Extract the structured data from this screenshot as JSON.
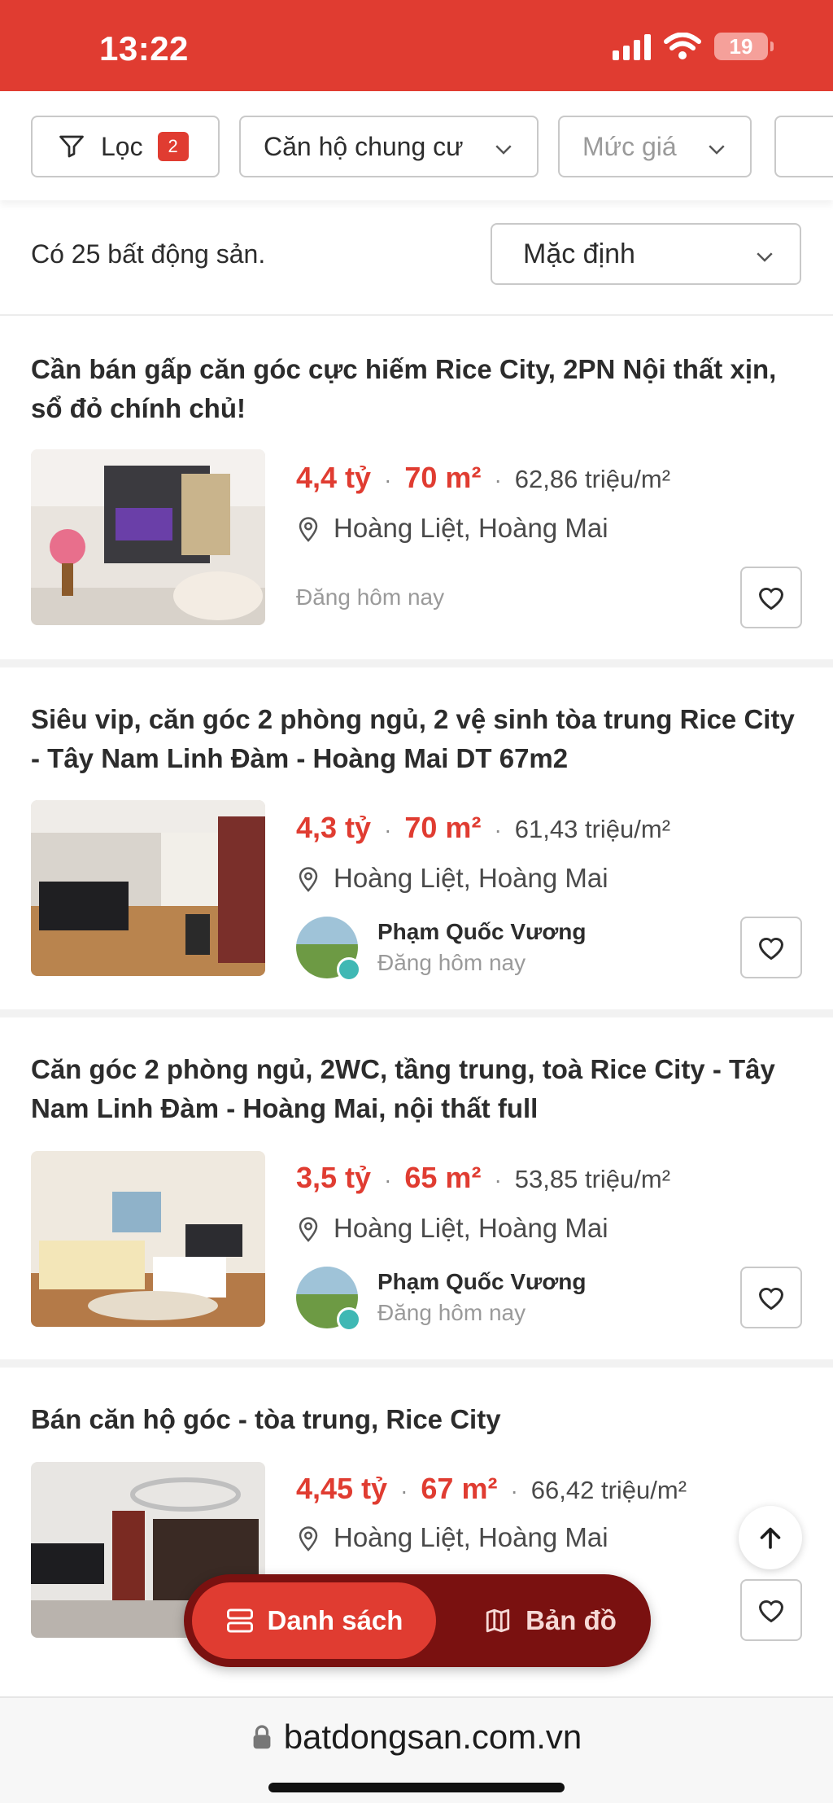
{
  "status_bar": {
    "time": "13:22",
    "battery": "19",
    "bg_color": "#e03c31"
  },
  "filters": {
    "filter_label": "Lọc",
    "filter_count": "2",
    "property_type": "Căn hộ chung cư",
    "price_placeholder": "Mức giá"
  },
  "results": {
    "count_text": "Có 25 bất động sản.",
    "sort_label": "Mặc định"
  },
  "listings": [
    {
      "title": "Cần bán gấp căn góc cực hiếm Rice City, 2PN Nội thất xịn, sổ đỏ chính chủ!",
      "price": "4,4 tỷ",
      "area": "70 m²",
      "price_per_m2": "62,86 triệu/m²",
      "location": "Hoàng Liệt, Hoàng Mai",
      "posted": "Đăng hôm nay"
    },
    {
      "title": "Siêu vip, căn góc 2 phòng ngủ, 2 vệ sinh tòa trung Rice City - Tây Nam Linh Đàm - Hoàng Mai DT 67m2",
      "price": "4,3 tỷ",
      "area": "70 m²",
      "price_per_m2": "61,43 triệu/m²",
      "location": "Hoàng Liệt, Hoàng Mai",
      "agent": "Phạm Quốc Vương",
      "posted": "Đăng hôm nay"
    },
    {
      "title": "Căn góc 2 phòng ngủ, 2WC, tầng trung, toà Rice City - Tây Nam Linh Đàm - Hoàng Mai, nội thất full",
      "price": "3,5 tỷ",
      "area": "65 m²",
      "price_per_m2": "53,85 triệu/m²",
      "location": "Hoàng Liệt, Hoàng Mai",
      "agent": "Phạm Quốc Vương",
      "posted": "Đăng hôm nay"
    },
    {
      "title": "Bán căn hộ góc - tòa trung, Rice City",
      "price": "4,45 tỷ",
      "area": "67 m²",
      "price_per_m2": "66,42 triệu/m²",
      "location": "Hoàng Liệt, Hoàng Mai"
    }
  ],
  "view_toggle": {
    "list_label": "Danh sách",
    "map_label": "Bản đồ"
  },
  "browser": {
    "url": "batdongsan.com.vn"
  },
  "colors": {
    "accent": "#e03c31",
    "toggle_dark": "#7a1110"
  }
}
